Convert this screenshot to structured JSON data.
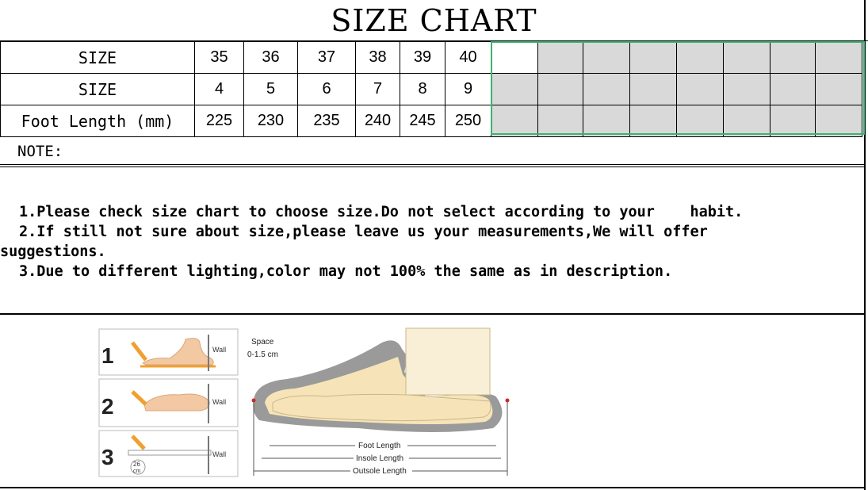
{
  "title": "SIZE CHART",
  "table": {
    "rows": [
      {
        "label": "SIZE",
        "values": [
          "35",
          "36",
          "37",
          "38",
          "39",
          "40"
        ]
      },
      {
        "label": "SIZE",
        "values": [
          "4",
          "5",
          "6",
          "7",
          "8",
          "9"
        ]
      },
      {
        "label": "Foot Length (mm)",
        "values": [
          "225",
          "230",
          "235",
          "240",
          "245",
          "250"
        ]
      }
    ]
  },
  "note_label": "NOTE:",
  "notes": {
    "line1": "1.Please check size chart to choose size.Do not select according to your    habit.",
    "line2": "2.If still not sure about size,please leave us your measurements,We will offer",
    "line2b": "suggestions.",
    "line3": "3.Due to different lighting,color may not 100% the same as in description."
  },
  "diagram": {
    "steps": [
      "1",
      "2",
      "3"
    ],
    "wall_label": "Wall",
    "ruler_value": "26",
    "ruler_unit": "cm",
    "space_label": "Space",
    "space_value": "0-1.5 cm",
    "foot_length": "Foot Length",
    "insole_length": "Insole Length",
    "outsole_length": "Outsole Length"
  },
  "colors": {
    "accent_frame": "#3cb371",
    "empty_cell": "#d9d9d9",
    "foot": "#f6e4b8",
    "sole": "#9a9a9a",
    "measure_tool": "#f0a030"
  }
}
